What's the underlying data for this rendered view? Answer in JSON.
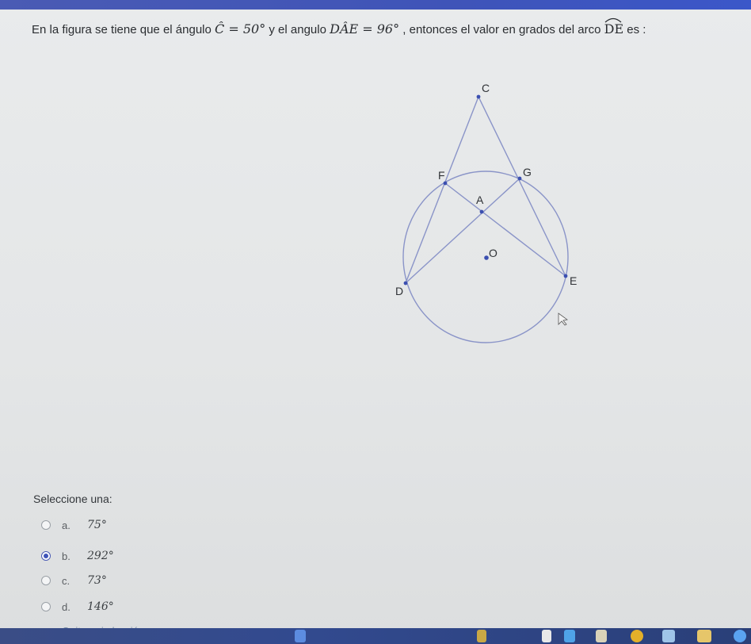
{
  "question": {
    "prefix": "En la figura se tiene que el ángulo",
    "angle_c": "Ĉ = 50°",
    "mid": "y el angulo",
    "angle_dae": "DÂE = 96°",
    "suffix": ", entonces  el valor en grados  del arco",
    "arc_de": "DE",
    "end": "es :"
  },
  "figure": {
    "points": {
      "C": "C",
      "F": "F",
      "G": "G",
      "A": "A",
      "O": "O",
      "D": "D",
      "E": "E"
    },
    "colors": {
      "lines": "#8a94c8",
      "points": "#3b4fb0",
      "labels": "#2f3236"
    }
  },
  "select_label": "Seleccione una:",
  "options": [
    {
      "letter": "a.",
      "value": "75°",
      "checked": false
    },
    {
      "letter": "b.",
      "value": "292°",
      "checked": true
    },
    {
      "letter": "c.",
      "value": "73°",
      "checked": false
    },
    {
      "letter": "d.",
      "value": "146°",
      "checked": false
    }
  ],
  "clear_choice": "Quitar mi elección",
  "colors": {
    "accent": "#3f54b8",
    "background": "#e6e8e9",
    "taskbar": "#324a8f"
  }
}
